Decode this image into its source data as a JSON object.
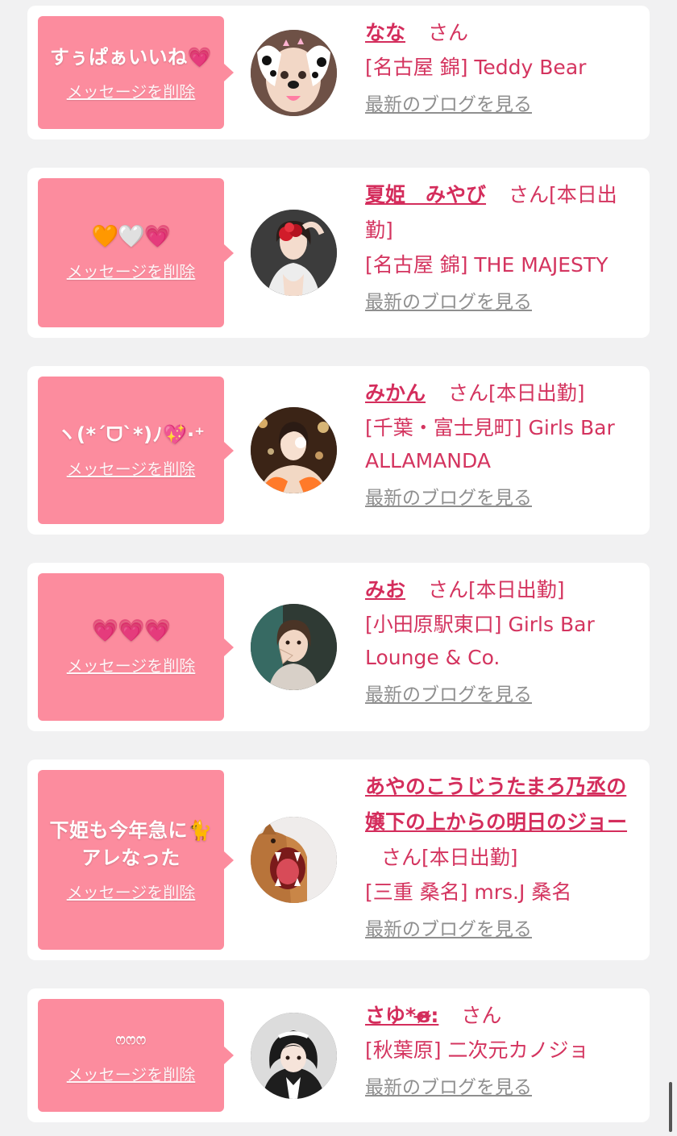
{
  "san_suffix": "さん",
  "delete_label": "メッセージを削除",
  "blog_label": "最新のブログを見る",
  "cards": [
    {
      "message": "すぅぱぁいいね💗",
      "name": "なな",
      "status": "",
      "shop": "[名古屋 錦] Teddy Bear",
      "avatar_icon": "dog-filter-face"
    },
    {
      "message": "🧡🤍💗",
      "name": "夏姫　みやび",
      "status": "[本日出勤]",
      "shop": "[名古屋 錦] THE MAJESTY",
      "avatar_icon": "woman-with-rose"
    },
    {
      "message": "ヽ(*´ᗜ`*)ﾉ💖‧⁺",
      "name": "みかん",
      "status": "[本日出勤]",
      "shop": "[千葉・富士見町] Girls Bar ALLAMANDA",
      "avatar_icon": "woman-bokeh"
    },
    {
      "message": "💗💗💗",
      "name": "みお",
      "status": "[本日出勤]",
      "shop": "[小田原駅東口] Girls Bar Lounge & Co.",
      "avatar_icon": "woman-selfie"
    },
    {
      "message": "下姫も今年急に🐈アレなった",
      "name": "あやのこうじうたまろ乃丞の嬢下の上からの明日のジョー",
      "status": "[本日出勤]",
      "shop": "[三重 桑名] mrs.J 桑名",
      "avatar_icon": "yawning-cat"
    },
    {
      "message": "ෆෆෆ",
      "name": "さゆ*ɞ̴̶̷:",
      "status": "",
      "shop": "[秋葉原] 二次元カノジョ",
      "avatar_icon": "woman-maid"
    }
  ],
  "colors": {
    "background": "#f1f1f2",
    "bubble": "#fc8c9e",
    "accent": "#d4345f",
    "link_gray": "#8f8f8f"
  }
}
